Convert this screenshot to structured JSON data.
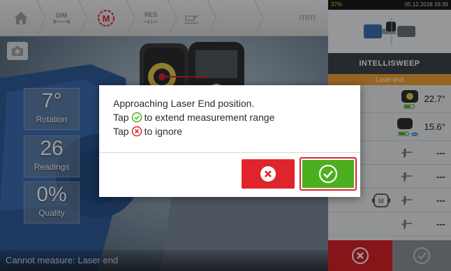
{
  "toolbar": {
    "dim_label": "DIM",
    "m_label": "M",
    "res_label": "RES",
    "unit_label": "mm"
  },
  "stats": [
    {
      "value": "7°",
      "label": "Rotation"
    },
    {
      "value": "26",
      "label": "Readings"
    },
    {
      "value": "0%",
      "label": "Quality"
    }
  ],
  "status": {
    "text": "Cannot measure: Laser end"
  },
  "sysbar": {
    "battery": "37%",
    "datetime": "05.12.2018 16:39"
  },
  "panel": {
    "title": "INTELLISWEEP",
    "subtitle": "Laser end",
    "sensor_angle": "22.7°",
    "laser_angle": "15.6°",
    "readouts": [
      "---",
      "---",
      "---",
      "---"
    ],
    "machine_marker": "M"
  },
  "dialog": {
    "line1": "Approaching Laser End position.",
    "line2_prefix": "Tap",
    "line2_suffix": "to extend measurement range",
    "line3_prefix": "Tap",
    "line3_suffix": "to ignore"
  },
  "colors": {
    "accent_orange": "#f2a33a",
    "cancel_red": "#e0242b",
    "ok_green": "#4caf1e",
    "panel_dark": "#3e4349"
  }
}
